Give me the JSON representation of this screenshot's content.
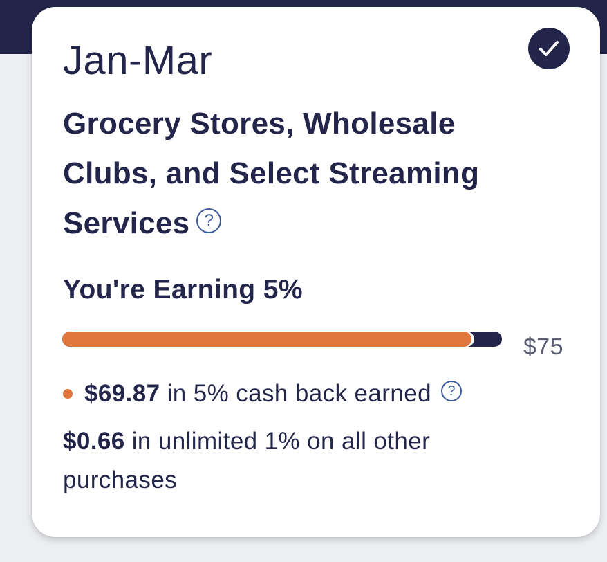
{
  "card": {
    "period": "Jan-Mar",
    "category": "Grocery Stores, Wholesale Clubs, and Select Streaming Services",
    "help_glyph": "?",
    "selected_icon": "checkmark-icon",
    "earning_rate": "You're Earning 5%",
    "progress": {
      "earned": 69.87,
      "goal": 75,
      "fraction": 0.9316,
      "goal_label": "$75",
      "fill_color": "#e0773c",
      "track_color": "#23264a"
    },
    "cashback": {
      "amount": "$69.87",
      "text": " in 5% cash back earned"
    },
    "unlimited": {
      "amount": "$0.66",
      "text": " in unlimited 1% on all other purchases"
    }
  },
  "colors": {
    "navy": "#23264a",
    "orange": "#e0773c",
    "help_blue": "#3b5a9b",
    "muted_text": "#5b5e74",
    "background": "#eceef1"
  }
}
